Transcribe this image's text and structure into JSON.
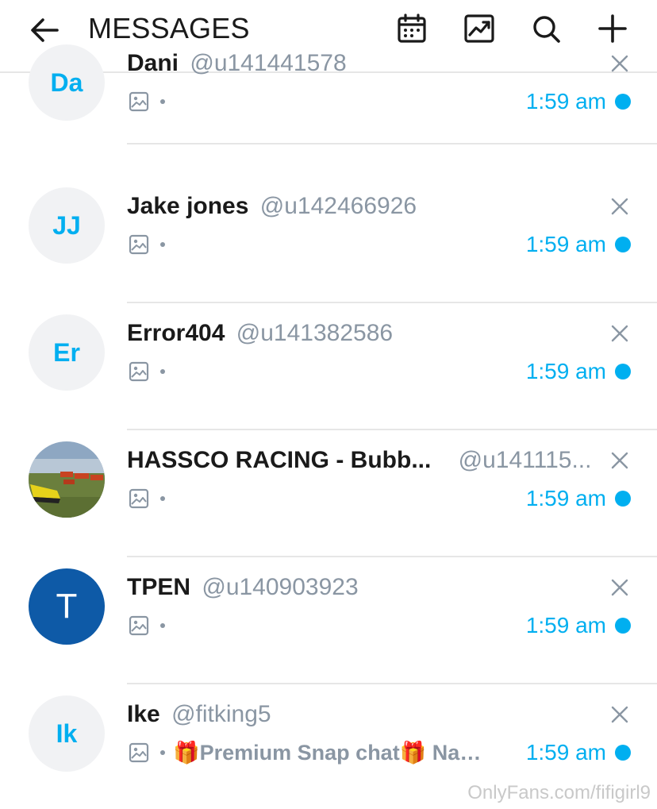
{
  "header": {
    "title": "MESSAGES",
    "icons": [
      "back-arrow-icon",
      "calendar-icon",
      "stats-chart-icon",
      "search-icon",
      "plus-icon"
    ]
  },
  "colors": {
    "accent": "#00aff0",
    "muted": "#8a96a3",
    "divider": "#e6e6e6",
    "avatar_bg": "#f1f2f4",
    "avatar_blue": "#0e5aa7"
  },
  "chats": [
    {
      "initials": "Da",
      "name": "Dani",
      "username": "@u141441578",
      "preview": "",
      "time": "1:59 am",
      "avatar_style": "initials"
    },
    {
      "initials": "JJ",
      "name": "Jake jones",
      "username": "@u142466926",
      "preview": "",
      "time": "1:59 am",
      "avatar_style": "initials"
    },
    {
      "initials": "Er",
      "name": "Error404",
      "username": "@u141382586",
      "preview": "",
      "time": "1:59 am",
      "avatar_style": "initials"
    },
    {
      "initials": "",
      "name": "HASSCO RACING - Bubb...",
      "username": "@u141115...",
      "preview": "",
      "time": "1:59 am",
      "avatar_style": "photo"
    },
    {
      "initials": "T",
      "name": "TPEN",
      "username": "@u140903923",
      "preview": "",
      "time": "1:59 am",
      "avatar_style": "blue"
    },
    {
      "initials": "Ik",
      "name": "Ike",
      "username": "@fitking5",
      "preview": "🎁Premium Snap chat🎁 Nake...",
      "time": "1:59 am",
      "avatar_style": "initials"
    }
  ],
  "watermark": "OnlyFans.com/fifigirl9"
}
